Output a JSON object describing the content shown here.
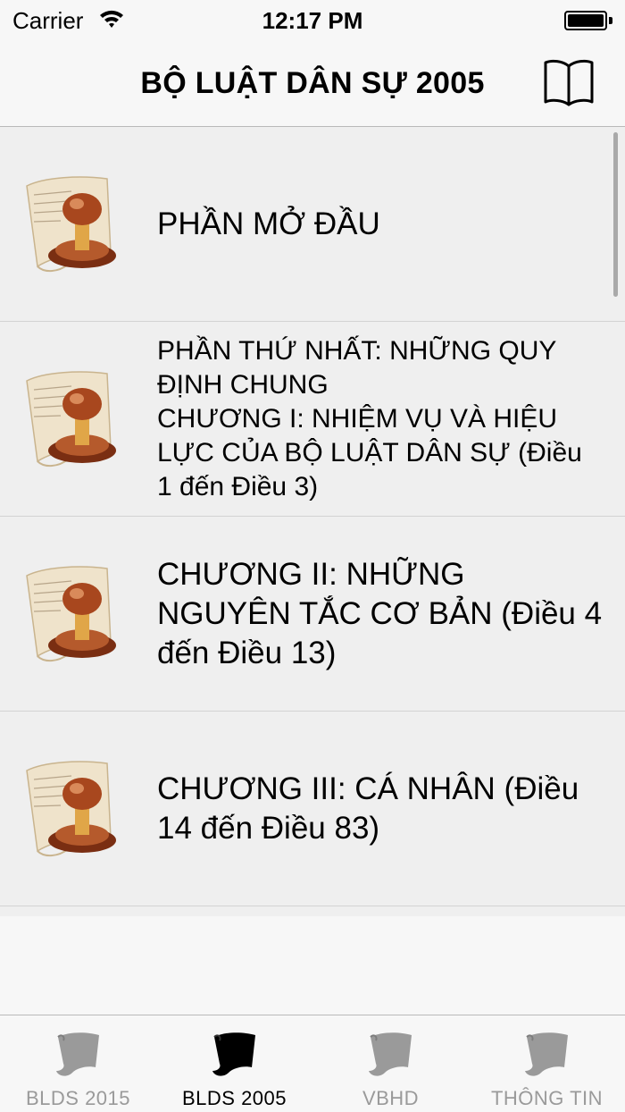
{
  "status_bar": {
    "carrier": "Carrier",
    "time": "12:17 PM"
  },
  "nav": {
    "title": "BỘ LUẬT DÂN SỰ 2005",
    "book_icon": "open-book-icon"
  },
  "list": {
    "items": [
      {
        "label": "PHẦN MỞ ĐẦU"
      },
      {
        "label": "PHẦN THỨ NHẤT: NHỮNG QUY ĐỊNH CHUNG\nCHƯƠNG I: NHIỆM VỤ VÀ HIỆU LỰC CỦA BỘ LUẬT DÂN SỰ (Điều 1 đến Điều 3)"
      },
      {
        "label": "CHƯƠNG II: NHỮNG NGUYÊN TẮC CƠ BẢN (Điều 4 đến Điều 13)"
      },
      {
        "label": "CHƯƠNG III: CÁ NHÂN (Điều 14 đến Điều 83)"
      }
    ],
    "item_icon": "scroll-stamp-icon"
  },
  "tabs": [
    {
      "label": "BLDS 2015",
      "active": false,
      "icon": "scroll-icon"
    },
    {
      "label": "BLDS 2005",
      "active": true,
      "icon": "scroll-icon"
    },
    {
      "label": "VBHD",
      "active": false,
      "icon": "scroll-icon"
    },
    {
      "label": "THÔNG TIN",
      "active": false,
      "icon": "scroll-icon"
    }
  ],
  "colors": {
    "active_tab": "#000000",
    "inactive_tab": "#9a9a9a",
    "list_bg": "#efefef"
  }
}
